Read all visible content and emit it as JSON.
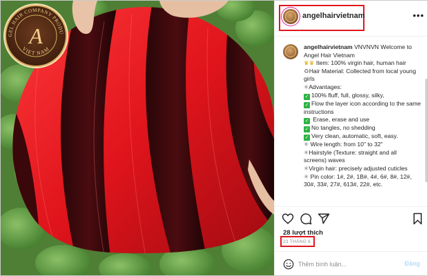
{
  "logo": {
    "arc_top": "ANGEL HAIR COMPANY PRODUCTS",
    "arc_bottom": "VIET NAM",
    "monogram": "A"
  },
  "post": {
    "username": "angelhairvietnam",
    "more_icon": "more-horizontal-icon",
    "caption": {
      "username": "angelhairvietnam",
      "lines": [
        "VNVNVN Welcome to Angel Hair Vietnam",
        "Item: 100% virgin hair, human hair",
        "Hair Material: Collected from local young girls",
        "Advantages:",
        "100% fluff, full, glossy, silky,",
        "Flow the layer icon according to the same instructions",
        "Erase, erase and use",
        "No tangles, no shedding",
        "Very clean, automatic, soft, easy.",
        "Wire length: from 10\" to 32\"",
        "Hairstyle (Texture: straight and all screens) waves",
        "Virgin hair: precisely adjusted cuticles",
        "Pin color: 1#, 2#, 1B#, 4#, 6#, 8#, 12#, 30#, 33#, 27#, 613#, 22#, etc."
      ]
    },
    "likes": "28 lượt thích",
    "date": "23 THÁNG 6",
    "comment_placeholder": "Thêm bình luận...",
    "post_button": "Đăng"
  },
  "colors": {
    "highlight_box": "#e0151d",
    "check_green": "#2fb344",
    "post_button_disabled": "#b2dffc"
  }
}
